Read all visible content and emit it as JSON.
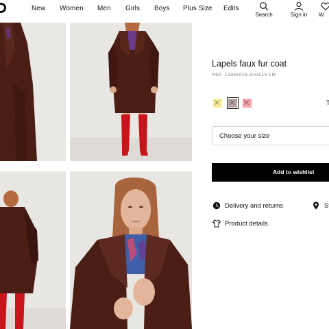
{
  "header": {
    "nav": [
      "New",
      "Women",
      "Men",
      "Girls",
      "Boys",
      "Plus Size",
      "Edits"
    ],
    "utilities": {
      "search": "Search",
      "signin": "Sign in",
      "wishlist": "W"
    }
  },
  "product": {
    "title": "Lapels faux fur coat",
    "ref": "REF. 13055016-CHILLY-LM",
    "swatches": [
      {
        "color": "#f7ef9a",
        "selected": false
      },
      {
        "color": "#b9a6a4",
        "selected": true
      },
      {
        "color": "#f5a3aa",
        "selected": false
      }
    ],
    "edge_text": "T",
    "size_placeholder": "Choose your size",
    "wishlist_button": "Add to wishlist",
    "links": {
      "delivery": "Delivery and returns",
      "store": "St",
      "details": "Product details"
    }
  },
  "colors": {
    "coat": "#4a1d15",
    "boots": "#c8141a",
    "background": "#e9e7e3"
  }
}
